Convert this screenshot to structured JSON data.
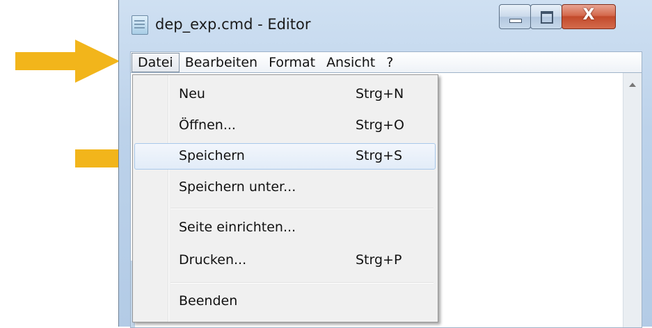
{
  "window": {
    "title": "dep_exp.cmd - Editor",
    "caption_close": "X"
  },
  "menubar": {
    "items": [
      "Datei",
      "Bearbeiten",
      "Format",
      "Ansicht",
      "?"
    ]
  },
  "file_menu": {
    "items": [
      {
        "label": "Neu",
        "shortcut": "Strg+N"
      },
      {
        "label": "Öffnen...",
        "shortcut": "Strg+O"
      },
      {
        "label": "Speichern",
        "shortcut": "Strg+S",
        "highlighted": true
      },
      {
        "label": "Speichern unter...",
        "shortcut": ""
      },
      {
        "label": "Seite einrichten...",
        "shortcut": ""
      },
      {
        "label": "Drucken...",
        "shortcut": "Strg+P"
      },
      {
        "label": "Beenden",
        "shortcut": ""
      }
    ]
  },
  "colors": {
    "arrow": "#f2b51b",
    "highlight_border": "#a8c8ea"
  },
  "icons": [
    "notepad-icon",
    "minimize-icon",
    "maximize-icon",
    "close-icon",
    "scroll-up-icon",
    "pointer-arrow-icon"
  ]
}
